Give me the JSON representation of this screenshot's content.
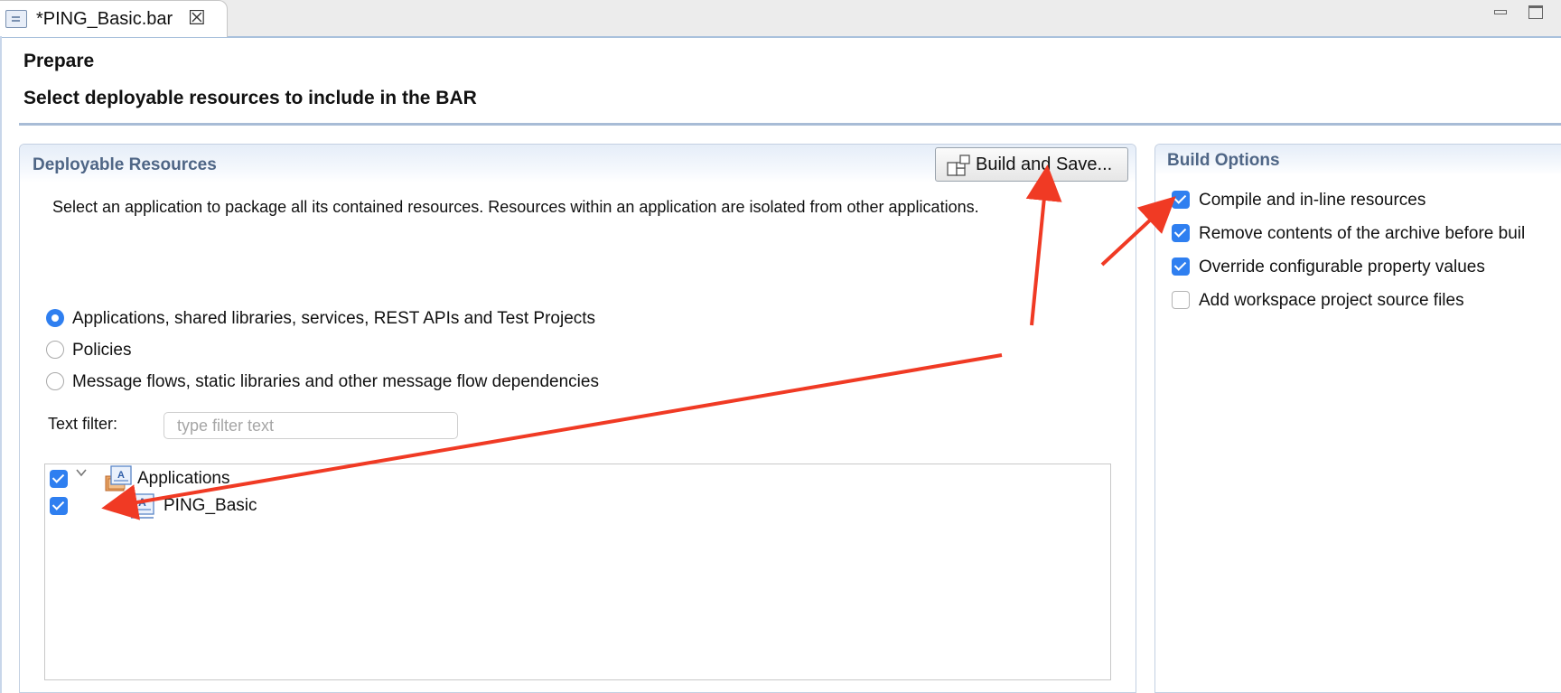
{
  "tab": {
    "title": "*PING_Basic.bar"
  },
  "header": {
    "title": "Prepare",
    "subtitle": "Select deployable resources to include in the BAR"
  },
  "deployable": {
    "title": "Deployable Resources",
    "build_button": "Build and Save...",
    "description": "Select an application to package all its contained resources. Resources within an application are isolated from other applications.",
    "radios": [
      {
        "label": "Applications, shared libraries, services, REST APIs and Test Projects",
        "selected": true
      },
      {
        "label": "Policies",
        "selected": false
      },
      {
        "label": "Message flows, static libraries and other message flow dependencies",
        "selected": false
      }
    ],
    "filter": {
      "label": "Text filter:",
      "placeholder": "type filter text",
      "value": ""
    },
    "tree": [
      {
        "label": "Applications",
        "checked": true,
        "expanded": true,
        "icon": "applications-folder-icon"
      },
      {
        "label": "PING_Basic",
        "checked": true,
        "icon": "application-icon"
      }
    ]
  },
  "build_options": {
    "title": "Build Options",
    "options": [
      {
        "label": "Compile and in-line resources",
        "checked": true
      },
      {
        "label": "Remove contents of the archive before buil",
        "checked": true
      },
      {
        "label": "Override configurable property values",
        "checked": true
      },
      {
        "label": "Add workspace project source files",
        "checked": false
      }
    ]
  },
  "colors": {
    "accent": "#2f7ff0",
    "annotation_arrow": "#f03a24",
    "section_title": "#4f6686"
  }
}
